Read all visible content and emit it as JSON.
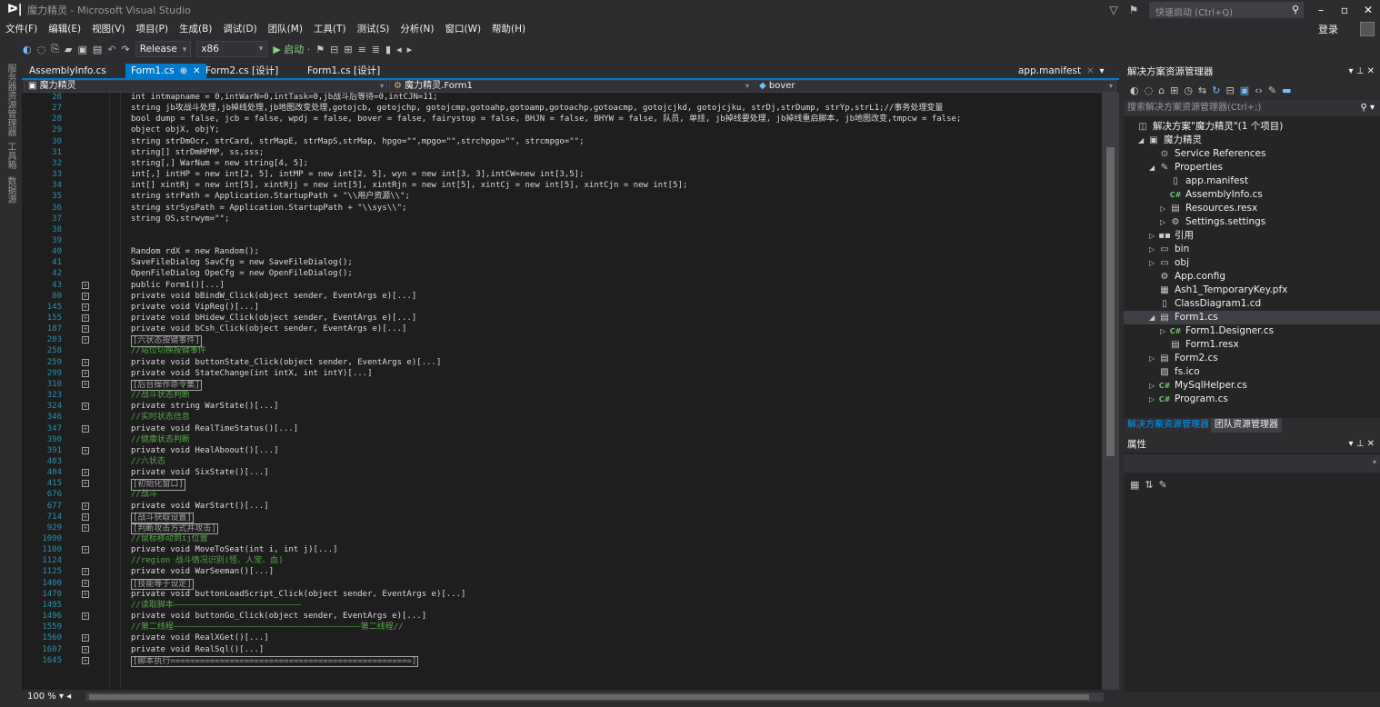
{
  "window": {
    "title": "魔力精灵 - Microsoft Visual Studio",
    "quick_launch_placeholder": "快速启动 (Ctrl+Q)",
    "controls": {
      "minimize": "–",
      "maximize": "▫",
      "close": "✕"
    }
  },
  "menu": {
    "items": [
      "文件(F)",
      "编辑(E)",
      "视图(V)",
      "项目(P)",
      "生成(B)",
      "调试(D)",
      "团队(M)",
      "工具(T)",
      "测试(S)",
      "分析(N)",
      "窗口(W)",
      "帮助(H)"
    ],
    "login": "登录"
  },
  "toolbar": {
    "config": "Release",
    "platform": "x86",
    "start_label": "▶ 启动 ·"
  },
  "left_tabs": [
    "服务器资源管理器",
    "工具箱",
    "数据源"
  ],
  "editor_tabs": [
    {
      "label": "AssemblyInfo.cs"
    },
    {
      "label": "Form1.cs",
      "active": true
    },
    {
      "label": "Form2.cs [设计]"
    },
    {
      "label": "Form1.cs [设计]"
    },
    {
      "label": "app.manifest"
    }
  ],
  "nav": {
    "project": "魔力精灵",
    "class": "魔力精灵.Form1",
    "member": "bover"
  },
  "code_lines": [
    {
      "n": "26",
      "text": "int intmapname = 0,intWarN=0,intTask=0,jb战斗后等待=0,intCJN=11;"
    },
    {
      "n": "27",
      "text": "string jb攻战斗处理,jb掉线处理,jb地图改变处理,gotojcb, gotojchp, gotojcmp,gotoahp,gotoamp,gotoachp,gotoacmp, gotojcjkd, gotojcjku, strDj,strDump, strYp,strL1;//事务处理变量"
    },
    {
      "n": "28",
      "text": "bool dump = false, jcb = false, wpdj = false, bover = false, fairystop = false, BHJN = false, BHYW = false, 队员, 单挂, jb掉线要处理, jb掉线重启脚本, jb地图改变,tmpcw = false;"
    },
    {
      "n": "29",
      "text": "object objX, objY;"
    },
    {
      "n": "30",
      "text": "string strDmOcr, strCard, strMapE, strMapS,strMap, hpgo=\"\",mpgo=\"\",strchpgo=\"\", strcmpgo=\"\";"
    },
    {
      "n": "31",
      "text": "string[] strDmHPMP, ss,sss;"
    },
    {
      "n": "32",
      "text": "string[,] WarNum = new string[4, 5];"
    },
    {
      "n": "33",
      "text": "int[,] intHP = new int[2, 5], intMP = new int[2, 5], wyn = new int[3, 3],intCW=new int[3,5];"
    },
    {
      "n": "34",
      "text": "int[] xintRj = new int[5], xintRjj = new int[5], xintRjn = new int[5], xintCj = new int[5], xintCjn = new int[5];"
    },
    {
      "n": "35",
      "text": "string strPath = Application.StartupPath + \"\\\\用户资源\\\\\";"
    },
    {
      "n": "36",
      "text": "string strSysPath = Application.StartupPath + \"\\\\sys\\\\\";"
    },
    {
      "n": "37",
      "text": "string OS,strwym=\"\";"
    },
    {
      "n": "38",
      "text": ""
    },
    {
      "n": "39",
      "text": ""
    },
    {
      "n": "40",
      "text": "Random rdX = new Random();"
    },
    {
      "n": "41",
      "text": "SaveFileDialog SavCfg = new SaveFileDialog();"
    },
    {
      "n": "42",
      "text": "OpenFileDialog OpeCfg = new OpenFileDialog();"
    },
    {
      "n": "43",
      "text": "public Form1()[...]",
      "fold": true
    },
    {
      "n": "80",
      "text": "private void bBindW_Click(object sender, EventArgs e)[...]",
      "fold": true
    },
    {
      "n": "145",
      "text": "private void VipReg()[...]",
      "fold": true
    },
    {
      "n": "155",
      "text": "private void bHidew_Click(object sender, EventArgs e)[...]",
      "fold": true
    },
    {
      "n": "187",
      "text": "private void bCsh_Click(object sender, EventArgs e)[...]",
      "fold": true
    },
    {
      "n": "203",
      "text": "[六状态按键事件]",
      "fold": true
    },
    {
      "n": "258",
      "text": "//站位切换按键事件"
    },
    {
      "n": "259",
      "text": "private void buttonState_Click(object sender, EventArgs e)[...]",
      "fold": true
    },
    {
      "n": "299",
      "text": "private void StateChange(int intX, int intY)[...]",
      "fold": true
    },
    {
      "n": "310",
      "text": "[后台操作命令集]",
      "fold": true
    },
    {
      "n": "323",
      "text": "//战斗状态判断"
    },
    {
      "n": "324",
      "text": "private string WarState()[...]",
      "fold": true
    },
    {
      "n": "346",
      "text": "//实时状态信息"
    },
    {
      "n": "347",
      "text": "private void RealTimeStatus()[...]",
      "fold": true
    },
    {
      "n": "390",
      "text": "//健康状态判断"
    },
    {
      "n": "391",
      "text": "private void HealAboout()[...]",
      "fold": true
    },
    {
      "n": "403",
      "text": "//六状态"
    },
    {
      "n": "404",
      "text": "private void SixState()[...]",
      "fold": true
    },
    {
      "n": "415",
      "text": "[初始化窗口]",
      "fold": true
    },
    {
      "n": "676",
      "text": "//战斗"
    },
    {
      "n": "677",
      "text": "private void WarStart()[...]",
      "fold": true
    },
    {
      "n": "714",
      "text": "[战斗获取设置]",
      "fold": true
    },
    {
      "n": "929",
      "text": "[判断攻击方式并攻击]",
      "fold": true
    },
    {
      "n": "1090",
      "text": "//鼠标移动到ij位置"
    },
    {
      "n": "1100",
      "text": "private void MoveToSeat(int i, int j)[...]",
      "fold": true
    },
    {
      "n": "1124",
      "text": "//region 战斗情况识别(怪、人宠、血)"
    },
    {
      "n": "1125",
      "text": "private void WarSeeman()[...]",
      "fold": true
    },
    {
      "n": "1400",
      "text": "[技能等于设定]",
      "fold": true
    },
    {
      "n": "1470",
      "text": "private void buttonLoadScript_Click(object sender, EventArgs e)[...]",
      "fold": true
    },
    {
      "n": "1495",
      "text": "//读取脚本——————————————————————————"
    },
    {
      "n": "1496",
      "text": "private void buttonGo_Click(object sender, EventArgs e)[...]",
      "fold": true
    },
    {
      "n": "1559",
      "text": "//第二线程——————————————————————————————————————第二线程//"
    },
    {
      "n": "1560",
      "text": "private void RealXGet()[...]",
      "fold": true
    },
    {
      "n": "1607",
      "text": "private void RealSql()[...]",
      "fold": true
    },
    {
      "n": "1645",
      "text": "[脚本执行=================================================]",
      "fold": true
    }
  ],
  "zoom": "100 %",
  "solution_explorer": {
    "title": "解决方案资源管理器",
    "search_placeholder": "搜索解决方案资源管理器(Ctrl+;)",
    "items": [
      {
        "label": "解决方案\"魔力精灵\"(1 个项目)",
        "icon": "solution-icon",
        "glyph": "◫",
        "indent": 0,
        "exp": ""
      },
      {
        "label": "魔力精灵",
        "icon": "csproj-icon",
        "glyph": "▣",
        "indent": 1,
        "exp": "◢"
      },
      {
        "label": "Service References",
        "icon": "service-icon",
        "glyph": "⊙",
        "indent": 2,
        "exp": ""
      },
      {
        "label": "Properties",
        "icon": "wrench-icon",
        "glyph": "✎",
        "indent": 2,
        "exp": "◢"
      },
      {
        "label": "app.manifest",
        "icon": "file-icon",
        "glyph": "▯",
        "indent": 3,
        "exp": ""
      },
      {
        "label": "AssemblyInfo.cs",
        "icon": "csharp-icon",
        "glyph": "C#",
        "indent": 3,
        "exp": ""
      },
      {
        "label": "Resources.resx",
        "icon": "resx-icon",
        "glyph": "▤",
        "indent": 3,
        "exp": "▷"
      },
      {
        "label": "Settings.settings",
        "icon": "settings-icon",
        "glyph": "⚙",
        "indent": 3,
        "exp": "▷"
      },
      {
        "label": "引用",
        "icon": "references-icon",
        "glyph": "▪▪",
        "indent": 2,
        "exp": "▷"
      },
      {
        "label": "bin",
        "icon": "folder-icon",
        "glyph": "▭",
        "indent": 2,
        "exp": "▷"
      },
      {
        "label": "obj",
        "icon": "folder-icon",
        "glyph": "▭",
        "indent": 2,
        "exp": "▷"
      },
      {
        "label": "App.config",
        "icon": "config-icon",
        "glyph": "⚙",
        "indent": 2,
        "exp": ""
      },
      {
        "label": "Ash1_TemporaryKey.pfx",
        "icon": "key-icon",
        "glyph": "▦",
        "indent": 2,
        "exp": ""
      },
      {
        "label": "ClassDiagram1.cd",
        "icon": "diagram-icon",
        "glyph": "▯",
        "indent": 2,
        "exp": ""
      },
      {
        "label": "Form1.cs",
        "icon": "form-icon",
        "glyph": "▤",
        "indent": 2,
        "exp": "◢",
        "selected": true
      },
      {
        "label": "Form1.Designer.cs",
        "icon": "csharp-icon",
        "glyph": "C#",
        "indent": 3,
        "exp": "▷"
      },
      {
        "label": "Form1.resx",
        "icon": "resx-icon",
        "glyph": "▤",
        "indent": 3,
        "exp": ""
      },
      {
        "label": "Form2.cs",
        "icon": "form-icon",
        "glyph": "▤",
        "indent": 2,
        "exp": "▷"
      },
      {
        "label": "fs.ico",
        "icon": "ico-icon",
        "glyph": "▨",
        "indent": 2,
        "exp": ""
      },
      {
        "label": "MySqlHelper.cs",
        "icon": "csharp-icon",
        "glyph": "C#",
        "indent": 2,
        "exp": "▷"
      },
      {
        "label": "Program.cs",
        "icon": "csharp-icon",
        "glyph": "C#",
        "indent": 2,
        "exp": "▷"
      }
    ]
  },
  "bottom_tabs": {
    "solution": "解决方案资源管理器",
    "team": "团队资源管理器"
  },
  "properties": {
    "title": "属性"
  },
  "colors": {
    "accent": "#007acc",
    "editor_bg": "#1e1e1e",
    "keyword": "#569cd6",
    "type": "#4ec9b0",
    "string": "#d69d85",
    "comment": "#57a64a",
    "line_number": "#2b91af"
  }
}
